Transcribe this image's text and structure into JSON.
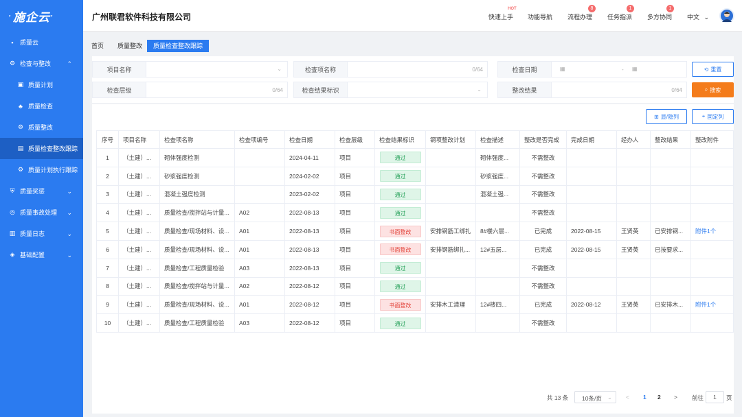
{
  "app": {
    "logo": "施企云",
    "company": "广州联君软件科技有限公司"
  },
  "sidebar": {
    "items": [
      {
        "label": "质量云",
        "icon": "grid-icon",
        "level": 0
      },
      {
        "label": "检查与整改",
        "icon": "gear-icon",
        "level": 0,
        "arrow": "^"
      },
      {
        "label": "质量计划",
        "icon": "clipboard-icon",
        "level": 1
      },
      {
        "label": "质量检查",
        "icon": "sitemap-icon",
        "level": 1
      },
      {
        "label": "质量整改",
        "icon": "gear-icon",
        "level": 1
      },
      {
        "label": "质量检查整改跟踪",
        "icon": "table-icon",
        "level": 1,
        "active": true
      },
      {
        "label": "质量计划执行跟踪",
        "icon": "gears-icon",
        "level": 1
      },
      {
        "label": "质量奖惩",
        "icon": "shield-icon",
        "level": 0,
        "arrow": "v"
      },
      {
        "label": "质量事故处理",
        "icon": "settings-icon",
        "level": 0,
        "arrow": "v"
      },
      {
        "label": "质量日志",
        "icon": "book-icon",
        "level": 0,
        "arrow": "v"
      },
      {
        "label": "基础配置",
        "icon": "layers-icon",
        "level": 0,
        "arrow": "v"
      }
    ]
  },
  "header": {
    "nav": [
      {
        "label": "快速上手",
        "hot": "HOT"
      },
      {
        "label": "功能导航"
      },
      {
        "label": "流程办理",
        "badge": "8"
      },
      {
        "label": "任务指派",
        "badge": "1"
      },
      {
        "label": "多方协同",
        "badge": "1"
      }
    ],
    "lang": "中文"
  },
  "tabs": [
    "首页",
    "质量整改",
    "质量检查整改跟踪"
  ],
  "filters": {
    "project_name": "项目名称",
    "item_name": "检查项名称",
    "item_count": "0/64",
    "check_date": "检查日期",
    "date_sep": "-",
    "level": "检查层级",
    "level_count": "0/64",
    "result_mark": "检查结果标识",
    "rect_result": "整改结果",
    "rect_count": "0/64",
    "reset": "重置",
    "search": "搜索"
  },
  "toolbar": {
    "show_hide": "显/隐列",
    "fixed": "固定列"
  },
  "table": {
    "headers": [
      "序号",
      "项目名称",
      "检查项名称",
      "检查项编号",
      "检查日期",
      "检查层级",
      "检查结果标识",
      "钢项整改计划",
      "检查描述",
      "整改是否完成",
      "完成日期",
      "经办人",
      "整改结果",
      "整改附件"
    ],
    "rows": [
      {
        "no": "1",
        "project": "（土建）...",
        "item": "砌体强度检测",
        "code": "",
        "date": "2024-04-11",
        "level": "项目",
        "result": "通过",
        "pass": true,
        "plan": "",
        "desc": "砌体强度...",
        "done": "不需整改",
        "finish": "",
        "handler": "",
        "rect": "",
        "attach": ""
      },
      {
        "no": "2",
        "project": "（土建）...",
        "item": "砂浆强度检测",
        "code": "",
        "date": "2024-02-02",
        "level": "项目",
        "result": "通过",
        "pass": true,
        "plan": "",
        "desc": "砂浆强度...",
        "done": "不需整改",
        "finish": "",
        "handler": "",
        "rect": "",
        "attach": ""
      },
      {
        "no": "3",
        "project": "（土建）...",
        "item": "混凝土强度检测",
        "code": "",
        "date": "2023-02-02",
        "level": "项目",
        "result": "通过",
        "pass": true,
        "plan": "",
        "desc": "混凝土强...",
        "done": "不需整改",
        "finish": "",
        "handler": "",
        "rect": "",
        "attach": ""
      },
      {
        "no": "4",
        "project": "（土建）...",
        "item": "质量检查/搅拌站与计量...",
        "code": "A02",
        "date": "2022-08-13",
        "level": "项目",
        "result": "通过",
        "pass": true,
        "plan": "",
        "desc": "",
        "done": "不需整改",
        "finish": "",
        "handler": "",
        "rect": "",
        "attach": ""
      },
      {
        "no": "5",
        "project": "（土建）...",
        "item": "质量检查/现场材料、设...",
        "code": "A01",
        "date": "2022-08-13",
        "level": "项目",
        "result": "书面整改",
        "pass": false,
        "plan": "安排钢筋工绑扎",
        "desc": "8#楼六层...",
        "done": "已完成",
        "finish": "2022-08-15",
        "handler": "王贤英",
        "rect": "已安排钢...",
        "attach": "附件1个"
      },
      {
        "no": "6",
        "project": "（土建）...",
        "item": "质量检查/现场材料、设...",
        "code": "A01",
        "date": "2022-08-13",
        "level": "项目",
        "result": "书面整改",
        "pass": false,
        "plan": "安排钢筋绑扎...",
        "desc": "12#五层...",
        "done": "已完成",
        "finish": "2022-08-15",
        "handler": "王贤英",
        "rect": "已按要求...",
        "attach": ""
      },
      {
        "no": "7",
        "project": "（土建）...",
        "item": "质量检查/工程质量检验",
        "code": "A03",
        "date": "2022-08-13",
        "level": "项目",
        "result": "通过",
        "pass": true,
        "plan": "",
        "desc": "",
        "done": "不需整改",
        "finish": "",
        "handler": "",
        "rect": "",
        "attach": ""
      },
      {
        "no": "8",
        "project": "（土建）...",
        "item": "质量检查/搅拌站与计量...",
        "code": "A02",
        "date": "2022-08-12",
        "level": "项目",
        "result": "通过",
        "pass": true,
        "plan": "",
        "desc": "",
        "done": "不需整改",
        "finish": "",
        "handler": "",
        "rect": "",
        "attach": ""
      },
      {
        "no": "9",
        "project": "（土建）...",
        "item": "质量检查/现场材料、设...",
        "code": "A01",
        "date": "2022-08-12",
        "level": "项目",
        "result": "书面整改",
        "pass": false,
        "plan": "安排木工清理",
        "desc": "12#楼四...",
        "done": "已完成",
        "finish": "2022-08-12",
        "handler": "王贤英",
        "rect": "已安排木...",
        "attach": "附件1个"
      },
      {
        "no": "10",
        "project": "（土建）...",
        "item": "质量检查/工程质量检验",
        "code": "A03",
        "date": "2022-08-12",
        "level": "项目",
        "result": "通过",
        "pass": true,
        "plan": "",
        "desc": "",
        "done": "不需整改",
        "finish": "",
        "handler": "",
        "rect": "",
        "attach": ""
      }
    ]
  },
  "pager": {
    "total": "共 13 条",
    "size": "10条/页",
    "pages": [
      "1",
      "2"
    ],
    "current": "1",
    "goto": "前往",
    "goto_value": "1",
    "unit": "页",
    "prev": "<",
    "next": ">"
  }
}
